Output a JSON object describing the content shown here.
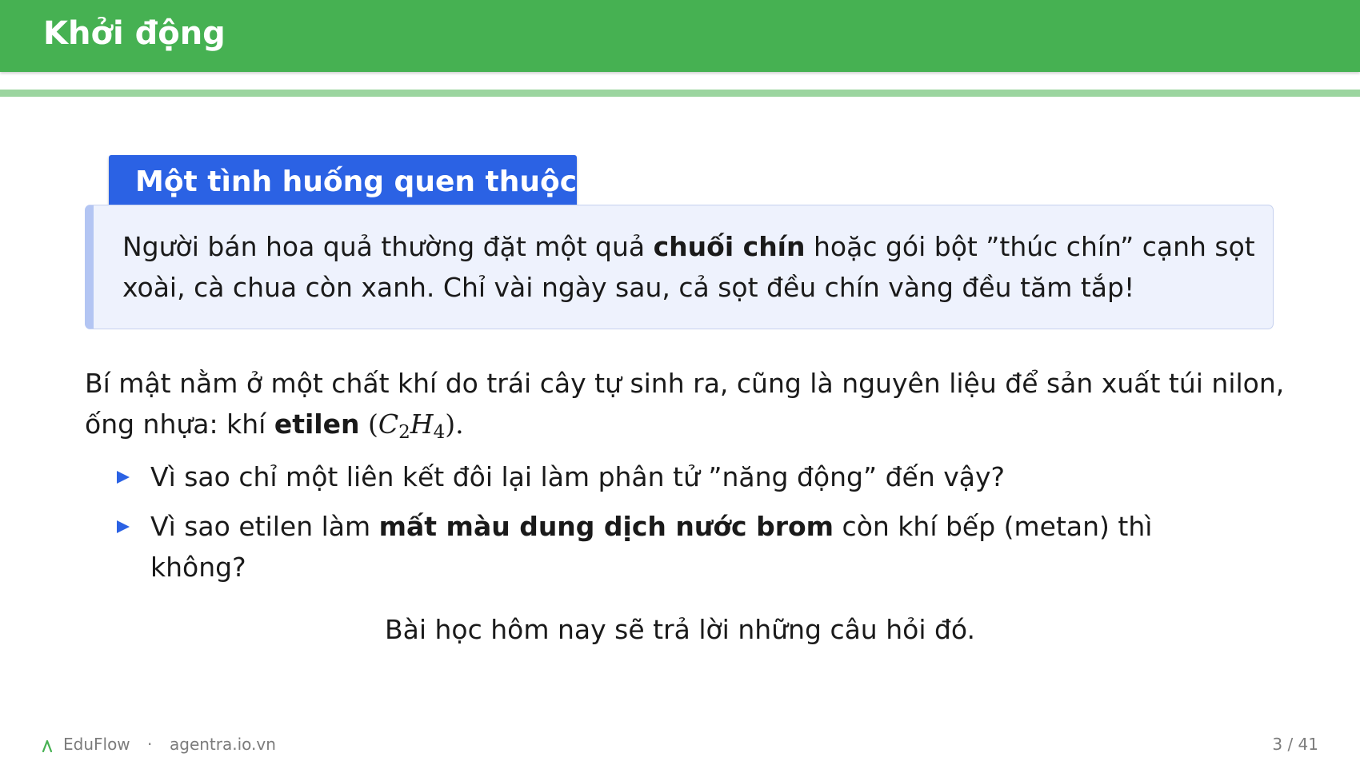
{
  "header": {
    "title": "Khởi động"
  },
  "block": {
    "title": "Một tình huống quen thuộc",
    "text_1": "Người bán hoa quả thường đặt một quả ",
    "text_bold": "chuối chín",
    "text_2": " hoặc gói bột ”thúc chín” cạnh sọt xoài, cà chua còn xanh.  Chỉ vài ngày sau, cả sọt đều chín vàng đều tăm tắp!"
  },
  "intro": {
    "text_1": "Bí mật nằm ở một chất khí do trái cây tự sinh ra, cũng là nguyên liệu để sản xuất túi nilon, ống nhựa: khí ",
    "text_bold": "etilen",
    "formula_open": " (",
    "formula_c": "C",
    "formula_c_sub": "2",
    "formula_h": "H",
    "formula_h_sub": "4",
    "formula_close": ")."
  },
  "bullets": [
    {
      "text": "Vì sao chỉ một liên kết đôi lại làm phân tử ”năng động” đến vậy?"
    },
    {
      "text_1": "Vì sao etilen làm ",
      "text_bold": "mất màu dung dịch nước brom",
      "text_2": " còn khí bếp (metan) thì không?"
    }
  ],
  "closing": "Bài học hôm nay sẽ trả lời những câu hỏi đó.",
  "footer": {
    "brand": "EduFlow",
    "separator": "·",
    "site": "agentra.io.vn",
    "page": "3 / 41"
  },
  "colors": {
    "header": "#46b152",
    "header_rule": "#9bd59f",
    "block_title": "#2b62e4",
    "block_body": "#eef2fd",
    "bullet": "#2b62e4"
  },
  "icons": {
    "footer_logo": "lambda-logo-icon",
    "bullet_marker": "triangle-right-icon"
  }
}
